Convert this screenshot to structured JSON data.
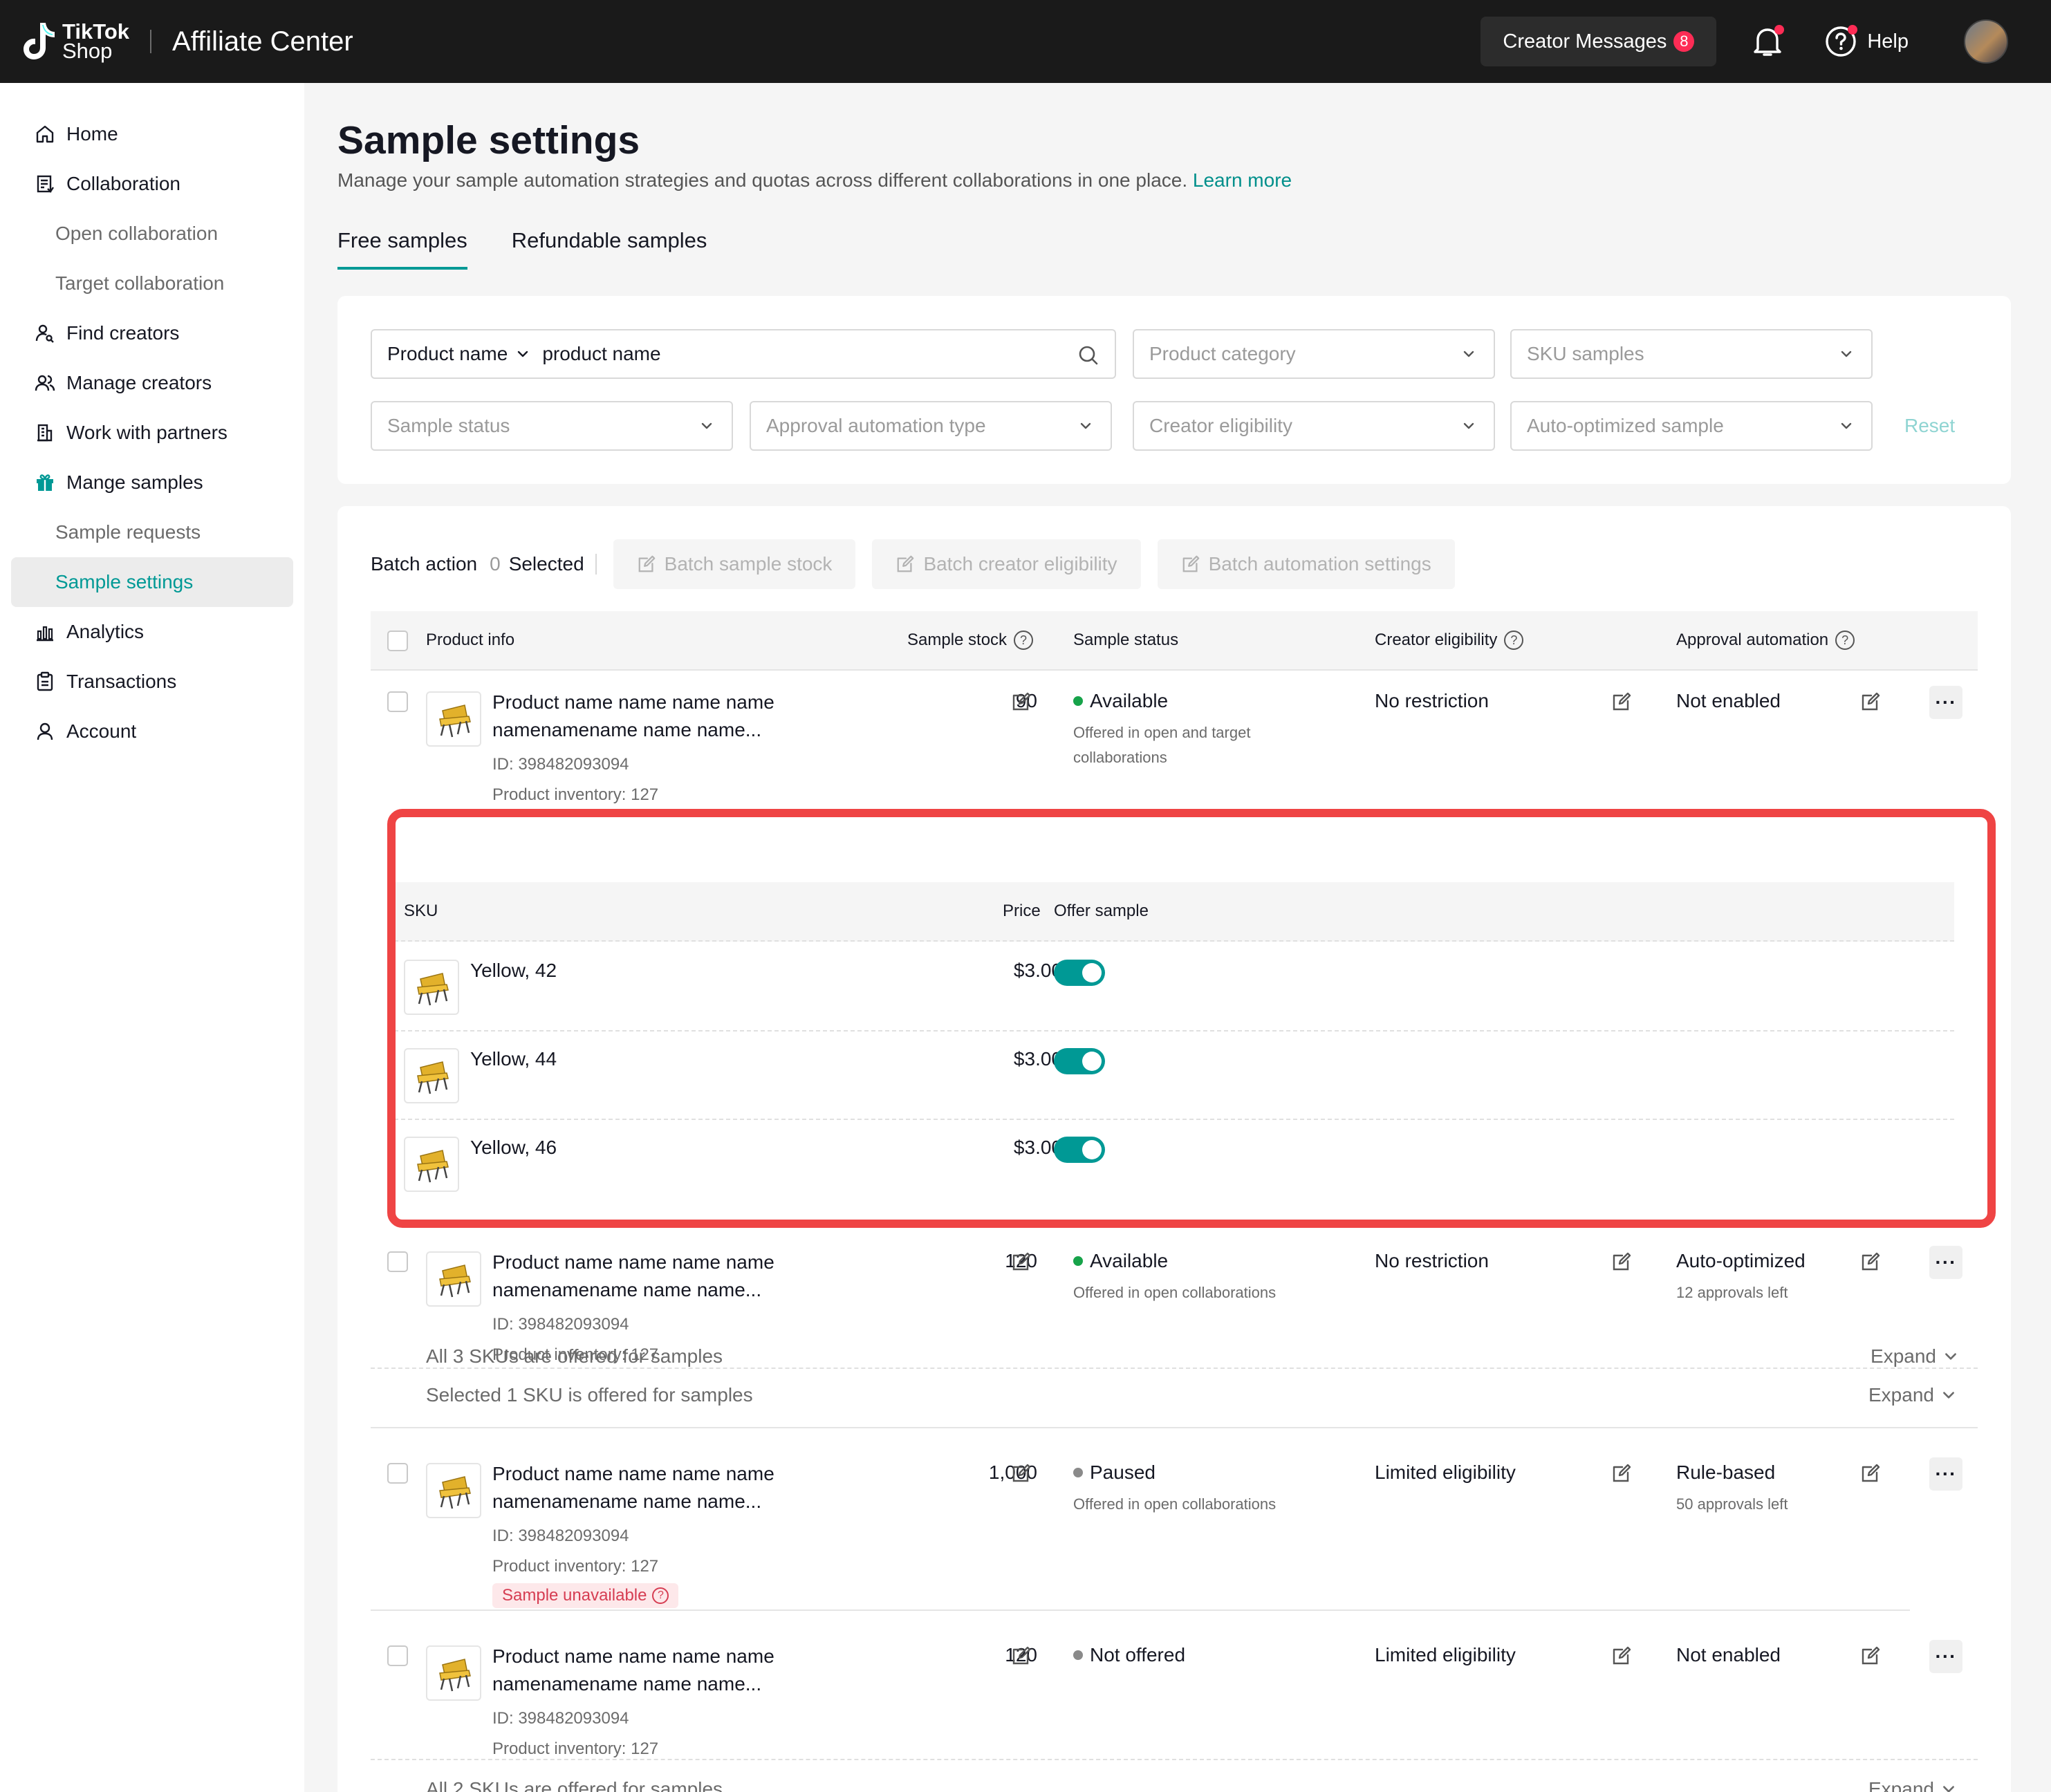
{
  "header": {
    "logo_line1": "TikTok",
    "logo_line2": "Shop",
    "app_title": "Affiliate Center",
    "creator_messages_label": "Creator Messages",
    "creator_messages_count": "8",
    "help_label": "Help"
  },
  "sidebar": {
    "items": [
      {
        "label": "Home",
        "icon": "home-icon"
      },
      {
        "label": "Collaboration",
        "icon": "document-icon"
      },
      {
        "label": "Open collaboration"
      },
      {
        "label": "Target collaboration"
      },
      {
        "label": "Find creators",
        "icon": "person-search-icon"
      },
      {
        "label": "Manage creators",
        "icon": "people-icon"
      },
      {
        "label": "Work with partners",
        "icon": "building-icon"
      },
      {
        "label": "Mange samples",
        "icon": "gift-icon"
      },
      {
        "label": "Sample requests"
      },
      {
        "label": "Sample settings",
        "active": true
      },
      {
        "label": "Analytics",
        "icon": "bar-chart-icon"
      },
      {
        "label": "Transactions",
        "icon": "clipboard-icon"
      },
      {
        "label": "Account",
        "icon": "user-icon"
      }
    ]
  },
  "page": {
    "title": "Sample settings",
    "description": "Manage your sample automation strategies and quotas across different collaborations in one place.",
    "learn_more": "Learn more",
    "tabs": [
      "Free samples",
      "Refundable samples"
    ]
  },
  "filters": {
    "search_type": "Product name",
    "search_value": "product name",
    "product_category": "Product category",
    "sku_samples": "SKU samples",
    "sample_status": "Sample status",
    "approval_automation_type": "Approval automation type",
    "creator_eligibility": "Creator eligibility",
    "auto_optimized_sample": "Auto-optimized sample",
    "reset": "Reset"
  },
  "batch": {
    "label": "Batch action",
    "count": "0",
    "selected": "Selected",
    "sample_stock": "Batch sample stock",
    "creator_eligibility": "Batch creator eligibility",
    "automation_settings": "Batch automation settings"
  },
  "table": {
    "columns": [
      "Product info",
      "Sample stock",
      "Sample status",
      "Creator eligibility",
      "Approval automation"
    ],
    "rows": [
      {
        "name_line1": "Product name name name name",
        "name_line2": "namenamename name name...",
        "id": "ID: 398482093094",
        "inventory": "Product inventory: 127",
        "stock": "90",
        "status": "Available",
        "status_sub_1": "Offered in open and target",
        "status_sub_2": "collaborations",
        "eligibility": "No restriction",
        "automation": "Not enabled",
        "automation_sub": "",
        "sku_summary": "All 3 SKUs are offered for samples",
        "expand": "Expand"
      },
      {
        "name_line1": "Product name name name name",
        "name_line2": "namenamename name name...",
        "id": "ID: 398482093094",
        "inventory": "Product inventory: 127",
        "stock": "120",
        "status": "Available",
        "status_sub_1": "Offered in open collaborations",
        "eligibility": "No restriction",
        "automation": "Auto-optimized",
        "automation_sub": "12 approvals left",
        "sku_summary": "Selected 1 SKU is offered for samples",
        "expand": "Expand"
      },
      {
        "name_line1": "Product name name name name",
        "name_line2": "namenamename name name...",
        "id": "ID: 398482093094",
        "inventory": "Product inventory: 127",
        "badge": "Sample unavailable",
        "stock": "1,000",
        "status": "Paused",
        "status_sub_1": "Offered in open collaborations",
        "eligibility": "Limited eligibility",
        "automation": "Rule-based",
        "automation_sub": "50 approvals left"
      },
      {
        "name_line1": "Product name name name name",
        "name_line2": "namenamename name name...",
        "id": "ID: 398482093094",
        "inventory": "Product inventory: 127",
        "stock": "120",
        "status": "Not offered",
        "eligibility": "Limited eligibility",
        "automation": "Not enabled",
        "sku_summary": "All 2 SKUs are offered for samples",
        "expand": "Expand"
      }
    ]
  },
  "sku_table": {
    "columns": [
      "SKU",
      "Price",
      "Offer sample"
    ],
    "rows": [
      {
        "name": "Yellow, 42",
        "price": "$3.00",
        "offered": true
      },
      {
        "name": "Yellow, 44",
        "price": "$3.00",
        "offered": true
      },
      {
        "name": "Yellow, 46",
        "price": "$3.00",
        "offered": true
      }
    ]
  },
  "colors": {
    "accent": "#009995",
    "available": "#17a34a",
    "highlight": "#ef4444",
    "topbar": "#1a1a1a"
  }
}
